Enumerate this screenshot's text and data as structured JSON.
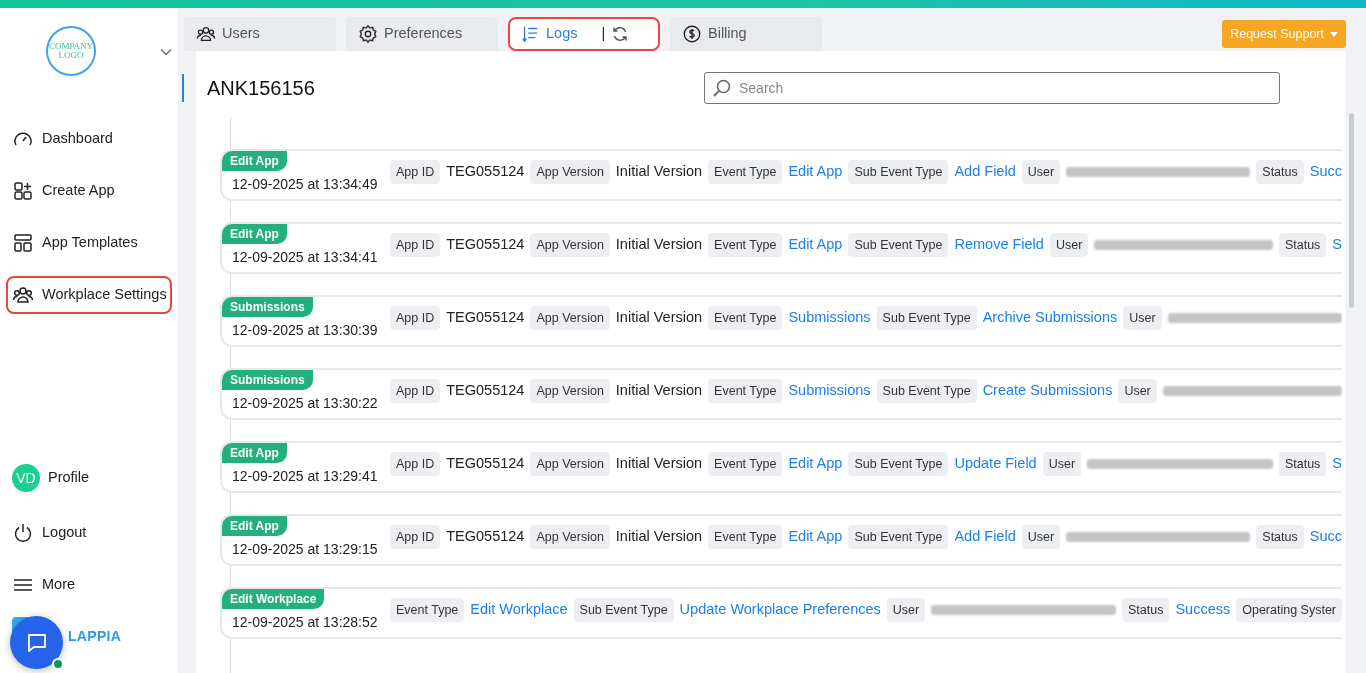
{
  "logo": {
    "lines": [
      "COMPANY",
      "LOGO"
    ]
  },
  "sidebar": {
    "items": [
      {
        "label": "Dashboard",
        "selected": false
      },
      {
        "label": "Create App",
        "selected": false
      },
      {
        "label": "App Templates",
        "selected": false
      },
      {
        "label": "Workplace Settings",
        "selected": true
      }
    ],
    "profile": {
      "initials": "VD",
      "label": "Profile"
    },
    "bottom_items": [
      {
        "label": "Logout"
      },
      {
        "label": "More"
      }
    ],
    "brand": "LAPPIA"
  },
  "tabs": [
    {
      "label": "Users",
      "selected": false
    },
    {
      "label": "Preferences",
      "selected": false
    },
    {
      "label": "Logs",
      "selected": true,
      "separator": "|"
    },
    {
      "label": "Billing",
      "selected": false
    }
  ],
  "request_button": "Request Support",
  "title": "ANK156156",
  "search": {
    "placeholder": "Search"
  },
  "logs": [
    {
      "tag": "Edit App",
      "date": "12-09-2025 at 13:34:49",
      "fields": [
        {
          "kind": "label",
          "text": "App ID"
        },
        {
          "kind": "value",
          "text": "TEG055124"
        },
        {
          "kind": "label",
          "text": "App Version"
        },
        {
          "kind": "value",
          "text": "Initial Version"
        },
        {
          "kind": "label",
          "text": "Event Type"
        },
        {
          "kind": "link",
          "text": "Edit App"
        },
        {
          "kind": "label",
          "text": "Sub Event Type"
        },
        {
          "kind": "link",
          "text": "Add Field"
        },
        {
          "kind": "label",
          "text": "User"
        },
        {
          "kind": "redacted"
        },
        {
          "kind": "label",
          "text": "Status"
        },
        {
          "kind": "link",
          "text": "Succ"
        }
      ]
    },
    {
      "tag": "Edit App",
      "date": "12-09-2025 at 13:34:41",
      "fields": [
        {
          "kind": "label",
          "text": "App ID"
        },
        {
          "kind": "value",
          "text": "TEG055124"
        },
        {
          "kind": "label",
          "text": "App Version"
        },
        {
          "kind": "value",
          "text": "Initial Version"
        },
        {
          "kind": "label",
          "text": "Event Type"
        },
        {
          "kind": "link",
          "text": "Edit App"
        },
        {
          "kind": "label",
          "text": "Sub Event Type"
        },
        {
          "kind": "link",
          "text": "Remove Field"
        },
        {
          "kind": "label",
          "text": "User"
        },
        {
          "kind": "redacted"
        },
        {
          "kind": "label",
          "text": "Status"
        },
        {
          "kind": "link",
          "text": "S"
        }
      ]
    },
    {
      "tag": "Submissions",
      "date": "12-09-2025 at 13:30:39",
      "fields": [
        {
          "kind": "label",
          "text": "App ID"
        },
        {
          "kind": "value",
          "text": "TEG055124"
        },
        {
          "kind": "label",
          "text": "App Version"
        },
        {
          "kind": "value",
          "text": "Initial Version"
        },
        {
          "kind": "label",
          "text": "Event Type"
        },
        {
          "kind": "link",
          "text": "Submissions"
        },
        {
          "kind": "label",
          "text": "Sub Event Type"
        },
        {
          "kind": "link",
          "text": "Archive Submissions"
        },
        {
          "kind": "label",
          "text": "User"
        },
        {
          "kind": "redacted"
        }
      ]
    },
    {
      "tag": "Submissions",
      "date": "12-09-2025 at 13:30:22",
      "fields": [
        {
          "kind": "label",
          "text": "App ID"
        },
        {
          "kind": "value",
          "text": "TEG055124"
        },
        {
          "kind": "label",
          "text": "App Version"
        },
        {
          "kind": "value",
          "text": "Initial Version"
        },
        {
          "kind": "label",
          "text": "Event Type"
        },
        {
          "kind": "link",
          "text": "Submissions"
        },
        {
          "kind": "label",
          "text": "Sub Event Type"
        },
        {
          "kind": "link",
          "text": "Create Submissions"
        },
        {
          "kind": "label",
          "text": "User"
        },
        {
          "kind": "redacted"
        }
      ]
    },
    {
      "tag": "Edit App",
      "date": "12-09-2025 at 13:29:41",
      "fields": [
        {
          "kind": "label",
          "text": "App ID"
        },
        {
          "kind": "value",
          "text": "TEG055124"
        },
        {
          "kind": "label",
          "text": "App Version"
        },
        {
          "kind": "value",
          "text": "Initial Version"
        },
        {
          "kind": "label",
          "text": "Event Type"
        },
        {
          "kind": "link",
          "text": "Edit App"
        },
        {
          "kind": "label",
          "text": "Sub Event Type"
        },
        {
          "kind": "link",
          "text": "Update Field"
        },
        {
          "kind": "label",
          "text": "User"
        },
        {
          "kind": "redacted"
        },
        {
          "kind": "label",
          "text": "Status"
        },
        {
          "kind": "link",
          "text": "S"
        }
      ]
    },
    {
      "tag": "Edit App",
      "date": "12-09-2025 at 13:29:15",
      "fields": [
        {
          "kind": "label",
          "text": "App ID"
        },
        {
          "kind": "value",
          "text": "TEG055124"
        },
        {
          "kind": "label",
          "text": "App Version"
        },
        {
          "kind": "value",
          "text": "Initial Version"
        },
        {
          "kind": "label",
          "text": "Event Type"
        },
        {
          "kind": "link",
          "text": "Edit App"
        },
        {
          "kind": "label",
          "text": "Sub Event Type"
        },
        {
          "kind": "link",
          "text": "Add Field"
        },
        {
          "kind": "label",
          "text": "User"
        },
        {
          "kind": "redacted"
        },
        {
          "kind": "label",
          "text": "Status"
        },
        {
          "kind": "link",
          "text": "Succ"
        }
      ]
    },
    {
      "tag": "Edit Workplace",
      "date": "12-09-2025 at 13:28:52",
      "fields": [
        {
          "kind": "label",
          "text": "Event Type"
        },
        {
          "kind": "link",
          "text": "Edit Workplace"
        },
        {
          "kind": "label",
          "text": "Sub Event Type"
        },
        {
          "kind": "link",
          "text": "Update Workplace Preferences"
        },
        {
          "kind": "label",
          "text": "User"
        },
        {
          "kind": "redacted"
        },
        {
          "kind": "label",
          "text": "Status"
        },
        {
          "kind": "link",
          "text": "Success"
        },
        {
          "kind": "label",
          "text": "Operating Syster"
        }
      ]
    }
  ]
}
